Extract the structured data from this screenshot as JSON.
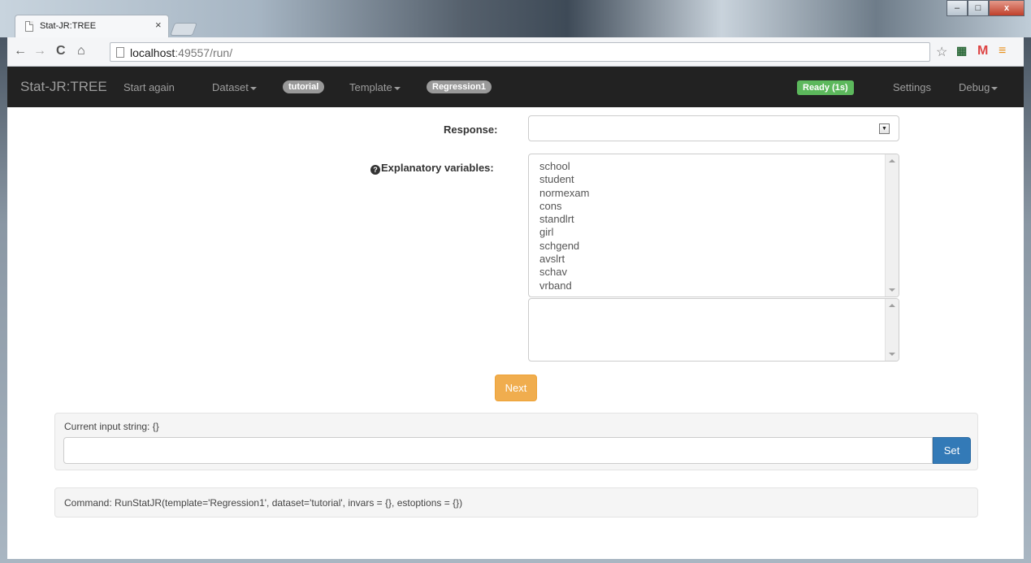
{
  "browser": {
    "tab_title": "Stat-JR:TREE",
    "tab_close": "×",
    "url_host": "localhost",
    "url_rest": ":49557/run/",
    "window_controls": {
      "minimize": "–",
      "maximize": "□",
      "close": "x"
    }
  },
  "navbar": {
    "brand": "Stat-JR:TREE",
    "start_again": "Start again",
    "dataset": "Dataset",
    "dataset_badge": "tutorial",
    "template": "Template",
    "template_badge": "Regression1",
    "status": "Ready (1s)",
    "settings": "Settings",
    "debug": "Debug"
  },
  "form": {
    "response_label": "Response:",
    "response_value": "",
    "explanatory_label": "Explanatory variables:",
    "variables": [
      "school",
      "student",
      "normexam",
      "cons",
      "standlrt",
      "girl",
      "schgend",
      "avslrt",
      "schav",
      "vrband"
    ],
    "next_button": "Next"
  },
  "input_panel": {
    "label": "Current input string: {}",
    "input_value": "",
    "set_button": "Set"
  },
  "command_panel": {
    "text": "Command: RunStatJR(template='Regression1', dataset='tutorial', invars = {}, estoptions = {})"
  },
  "colors": {
    "navbar_bg": "#222222",
    "ready_green": "#5cb85c",
    "next_orange": "#f0ad4e",
    "set_blue": "#337ab7"
  }
}
